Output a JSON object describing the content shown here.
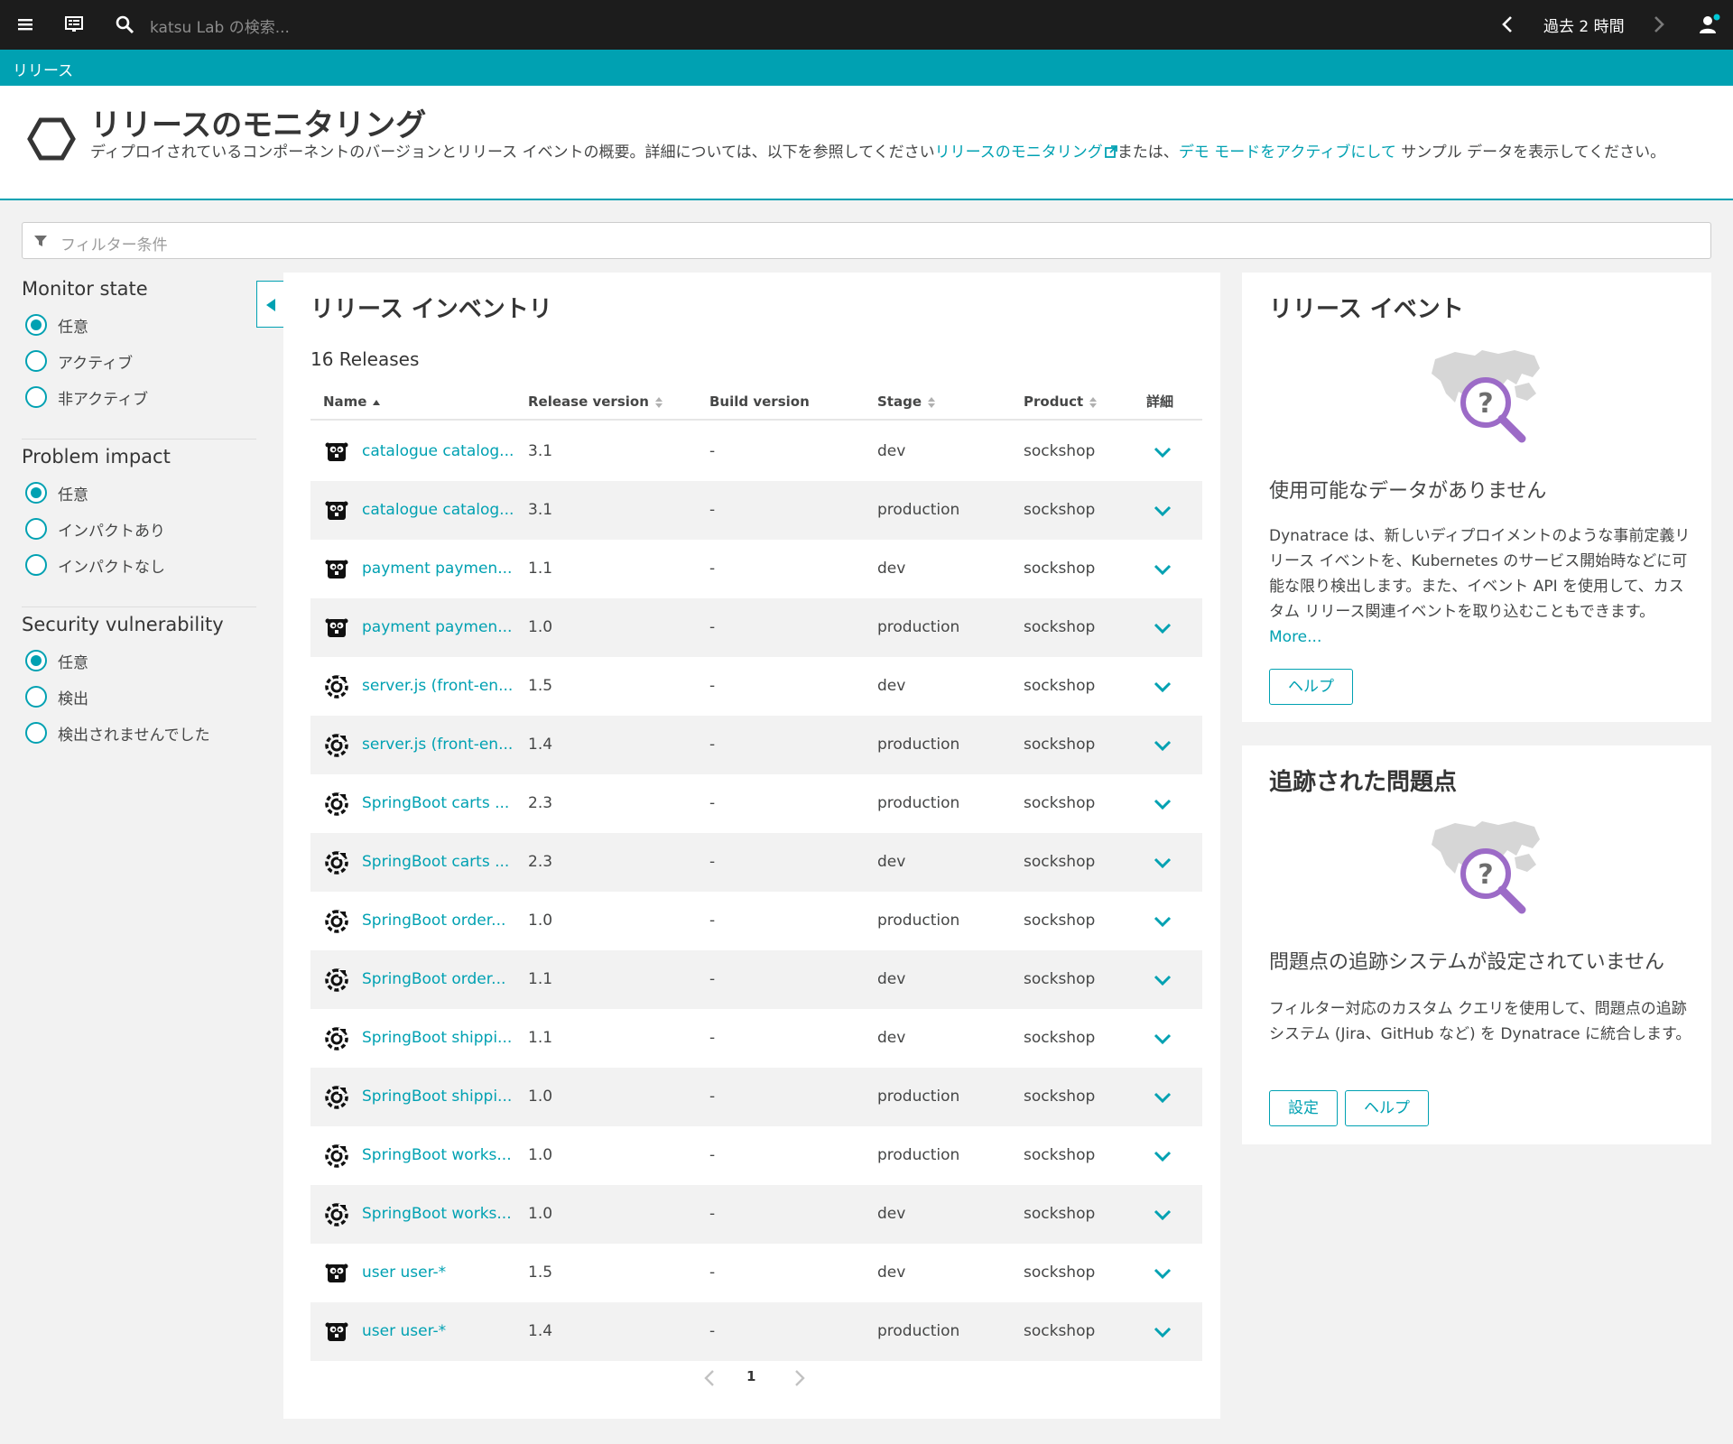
{
  "topbar": {
    "search_placeholder": "katsu Lab の検索...",
    "timeframe": "過去 2 時間"
  },
  "breadcrumb": "リリース",
  "header": {
    "title": "リリースのモニタリング",
    "desc_1": "ディプロイされているコンポーネントのバージョンとリリース イベントの概要。詳細については、以下を参照してください",
    "desc_link_1": "リリースのモニタリング",
    "desc_2": "または、",
    "desc_link_2": "デモ モードをアクティブにして",
    "desc_3": " サンプル データを表示してください。"
  },
  "filter": {
    "placeholder": "フィルター条件"
  },
  "sidebar": {
    "groups": [
      {
        "title": "Monitor state",
        "options": [
          "任意",
          "アクティブ",
          "非アクティブ"
        ],
        "selected": 0
      },
      {
        "title": "Problem impact",
        "options": [
          "任意",
          "インパクトあり",
          "インパクトなし"
        ],
        "selected": 0
      },
      {
        "title": "Security vulnerability",
        "options": [
          "任意",
          "検出",
          "検出されませんでした"
        ],
        "selected": 0
      }
    ]
  },
  "inventory": {
    "title": "リリース インベントリ",
    "count": "16 Releases",
    "columns": {
      "name": "Name",
      "release_version": "Release version",
      "build_version": "Build version",
      "stage": "Stage",
      "product": "Product",
      "details": "詳細"
    },
    "rows": [
      {
        "icon": "go-gopher-icon",
        "name": "catalogue catalog...",
        "release": "3.1",
        "build": "-",
        "stage": "dev",
        "product": "sockshop"
      },
      {
        "icon": "go-gopher-icon",
        "name": "catalogue catalog...",
        "release": "3.1",
        "build": "-",
        "stage": "production",
        "product": "sockshop"
      },
      {
        "icon": "go-gopher-icon",
        "name": "payment paymen...",
        "release": "1.1",
        "build": "-",
        "stage": "dev",
        "product": "sockshop"
      },
      {
        "icon": "go-gopher-icon",
        "name": "payment paymen...",
        "release": "1.0",
        "build": "-",
        "stage": "production",
        "product": "sockshop"
      },
      {
        "icon": "process-icon",
        "name": "server.js (front-en...",
        "release": "1.5",
        "build": "-",
        "stage": "dev",
        "product": "sockshop"
      },
      {
        "icon": "process-icon",
        "name": "server.js (front-en...",
        "release": "1.4",
        "build": "-",
        "stage": "production",
        "product": "sockshop"
      },
      {
        "icon": "process-icon",
        "name": "SpringBoot carts ...",
        "release": "2.3",
        "build": "-",
        "stage": "production",
        "product": "sockshop"
      },
      {
        "icon": "process-icon",
        "name": "SpringBoot carts ...",
        "release": "2.3",
        "build": "-",
        "stage": "dev",
        "product": "sockshop"
      },
      {
        "icon": "process-icon",
        "name": "SpringBoot order...",
        "release": "1.0",
        "build": "-",
        "stage": "production",
        "product": "sockshop"
      },
      {
        "icon": "process-icon",
        "name": "SpringBoot order...",
        "release": "1.1",
        "build": "-",
        "stage": "dev",
        "product": "sockshop"
      },
      {
        "icon": "process-icon",
        "name": "SpringBoot shippi...",
        "release": "1.1",
        "build": "-",
        "stage": "dev",
        "product": "sockshop"
      },
      {
        "icon": "process-icon",
        "name": "SpringBoot shippi...",
        "release": "1.0",
        "build": "-",
        "stage": "production",
        "product": "sockshop"
      },
      {
        "icon": "process-icon",
        "name": "SpringBoot works...",
        "release": "1.0",
        "build": "-",
        "stage": "production",
        "product": "sockshop"
      },
      {
        "icon": "process-icon",
        "name": "SpringBoot works...",
        "release": "1.0",
        "build": "-",
        "stage": "dev",
        "product": "sockshop"
      },
      {
        "icon": "go-gopher-icon",
        "name": "user user-*",
        "release": "1.5",
        "build": "-",
        "stage": "dev",
        "product": "sockshop"
      },
      {
        "icon": "go-gopher-icon",
        "name": "user user-*",
        "release": "1.4",
        "build": "-",
        "stage": "production",
        "product": "sockshop"
      }
    ],
    "page": "1"
  },
  "release_events": {
    "title": "リリース イベント",
    "subtitle": "使用可能なデータがありません",
    "text": "Dynatrace は、新しいディプロイメントのような事前定義リリース イベントを、Kubernetes のサービス開始時などに可能な限り検出します。また、イベント API を使用して、カスタム リリース関連イベントを取り込むこともできます。",
    "more": "More...",
    "help_button": "ヘルプ"
  },
  "tracked_problems": {
    "title": "追跡された問題点",
    "subtitle": "問題点の追跡システムが設定されていません",
    "text": "フィルター対応のカスタム クエリを使用して、問題点の追跡システム (Jira、GitHub など) を Dynatrace に統合します。",
    "settings_button": "設定",
    "help_button": "ヘルプ"
  },
  "colors": {
    "accent": "#00a1b2",
    "topbar": "#1c1c1c",
    "purple": "#9c6bc7"
  }
}
